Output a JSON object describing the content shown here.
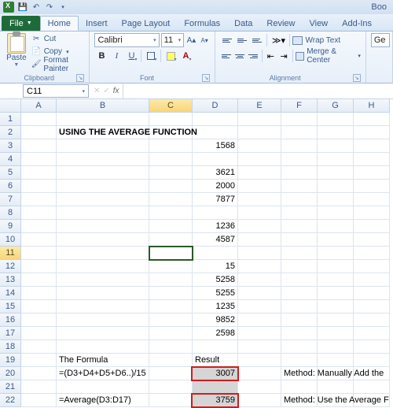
{
  "titlebar": {
    "app_title": "Boo"
  },
  "tabs": {
    "file": "File",
    "items": [
      "Home",
      "Insert",
      "Page Layout",
      "Formulas",
      "Data",
      "Review",
      "View",
      "Add-Ins"
    ],
    "active": "Home"
  },
  "ribbon": {
    "clipboard": {
      "label": "Clipboard",
      "paste": "Paste",
      "cut": "Cut",
      "copy": "Copy",
      "format_painter": "Format Painter"
    },
    "font": {
      "label": "Font",
      "name": "Calibri",
      "size": "11",
      "bold": "B",
      "italic": "I",
      "underline": "U",
      "font_color_letter": "A"
    },
    "alignment": {
      "label": "Alignment",
      "wrap": "Wrap Text",
      "merge": "Merge & Center"
    },
    "number": {
      "label": "",
      "format": "Ge"
    }
  },
  "namebox": {
    "ref": "C11"
  },
  "columns": [
    "A",
    "B",
    "C",
    "D",
    "E",
    "F",
    "G",
    "H"
  ],
  "sheet": {
    "B2": "USING THE AVERAGE FUNCTION",
    "D3": "1568",
    "D5": "3621",
    "D6": "2000",
    "D7": "7877",
    "D9": "1236",
    "D10": "4587",
    "D12": "15",
    "D13": "5258",
    "D14": "5255",
    "D15": "1235",
    "D16": "9852",
    "D17": "2598",
    "B19": "The Formula",
    "D19": "Result",
    "B20": "=(D3+D4+D5+D6..)/15",
    "D20": "3007",
    "F20": "Method: Manually Add the",
    "B22": "=Average(D3:D17)",
    "D22": "3759",
    "F22": "Method: Use the Average F"
  },
  "chart_data": {
    "type": "table",
    "title": "USING THE AVERAGE FUNCTION",
    "values": [
      1568,
      3621,
      2000,
      7877,
      1236,
      4587,
      15,
      5258,
      5255,
      1235,
      9852,
      2598
    ],
    "results": [
      {
        "formula": "=(D3+D4+D5+D6..)/15",
        "result": 3007,
        "method": "Manually Add"
      },
      {
        "formula": "=Average(D3:D17)",
        "result": 3759,
        "method": "Use the Average Function"
      }
    ]
  }
}
